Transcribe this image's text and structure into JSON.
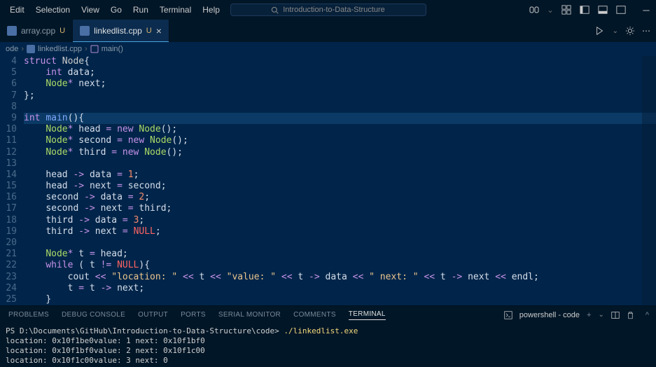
{
  "menu": [
    "Edit",
    "Selection",
    "View",
    "Go",
    "Run",
    "Terminal",
    "Help"
  ],
  "search_placeholder": "Introduction-to-Data-Structure",
  "tabs": [
    {
      "name": "array.cpp",
      "mod": "U",
      "active": false
    },
    {
      "name": "linkedlist.cpp",
      "mod": "U",
      "active": true
    }
  ],
  "breadcrumb": {
    "folder": "ode",
    "file": "linkedlist.cpp",
    "symbol": "main()"
  },
  "code_start_line": 4,
  "code_lines": [
    [
      [
        "kw",
        "struct"
      ],
      [
        "",
        ""
      ],
      [
        "",
        "Node"
      ],
      [
        "punc",
        "{"
      ]
    ],
    [
      [
        "",
        "    "
      ],
      [
        "kw",
        "int"
      ],
      [
        "",
        ""
      ],
      [
        "ident",
        "data"
      ],
      [
        "punc",
        ";"
      ]
    ],
    [
      [
        "",
        "    "
      ],
      [
        "type",
        "Node"
      ],
      [
        "op",
        "*"
      ],
      [
        "",
        ""
      ],
      [
        "ident",
        "next"
      ],
      [
        "punc",
        ";"
      ]
    ],
    [
      [
        "punc",
        "};"
      ]
    ],
    [],
    [
      [
        "kw",
        "int"
      ],
      [
        "",
        ""
      ],
      [
        "func",
        "main"
      ],
      [
        "punc",
        "()"
      ],
      [
        "punc",
        "{"
      ]
    ],
    [
      [
        "",
        "    "
      ],
      [
        "type",
        "Node"
      ],
      [
        "op",
        "*"
      ],
      [
        "",
        ""
      ],
      [
        "ident",
        "head"
      ],
      [
        "",
        ""
      ],
      [
        "op",
        "="
      ],
      [
        "",
        ""
      ],
      [
        "kw",
        "new"
      ],
      [
        "",
        ""
      ],
      [
        "type",
        "Node"
      ],
      [
        "punc",
        "();"
      ]
    ],
    [
      [
        "",
        "    "
      ],
      [
        "type",
        "Node"
      ],
      [
        "op",
        "*"
      ],
      [
        "",
        ""
      ],
      [
        "ident",
        "second"
      ],
      [
        "",
        ""
      ],
      [
        "op",
        "="
      ],
      [
        "",
        ""
      ],
      [
        "kw",
        "new"
      ],
      [
        "",
        ""
      ],
      [
        "type",
        "Node"
      ],
      [
        "punc",
        "();"
      ]
    ],
    [
      [
        "",
        "    "
      ],
      [
        "type",
        "Node"
      ],
      [
        "op",
        "*"
      ],
      [
        "",
        ""
      ],
      [
        "ident",
        "third"
      ],
      [
        "",
        ""
      ],
      [
        "op",
        "="
      ],
      [
        "",
        ""
      ],
      [
        "kw",
        "new"
      ],
      [
        "",
        ""
      ],
      [
        "type",
        "Node"
      ],
      [
        "punc",
        "();"
      ]
    ],
    [],
    [
      [
        "",
        "    "
      ],
      [
        "ident",
        "head"
      ],
      [
        "",
        ""
      ],
      [
        "op",
        "->"
      ],
      [
        "",
        ""
      ],
      [
        "ident",
        "data"
      ],
      [
        "",
        ""
      ],
      [
        "op",
        "="
      ],
      [
        "",
        ""
      ],
      [
        "num",
        "1"
      ],
      [
        "punc",
        ";"
      ]
    ],
    [
      [
        "",
        "    "
      ],
      [
        "ident",
        "head"
      ],
      [
        "",
        ""
      ],
      [
        "op",
        "->"
      ],
      [
        "",
        ""
      ],
      [
        "ident",
        "next"
      ],
      [
        "",
        ""
      ],
      [
        "op",
        "="
      ],
      [
        "",
        ""
      ],
      [
        "ident",
        "second"
      ],
      [
        "punc",
        ";"
      ]
    ],
    [
      [
        "",
        "    "
      ],
      [
        "ident",
        "second"
      ],
      [
        "",
        ""
      ],
      [
        "op",
        "->"
      ],
      [
        "",
        ""
      ],
      [
        "ident",
        "data"
      ],
      [
        "",
        ""
      ],
      [
        "op",
        "="
      ],
      [
        "",
        ""
      ],
      [
        "num",
        "2"
      ],
      [
        "punc",
        ";"
      ]
    ],
    [
      [
        "",
        "    "
      ],
      [
        "ident",
        "second"
      ],
      [
        "",
        ""
      ],
      [
        "op",
        "->"
      ],
      [
        "",
        ""
      ],
      [
        "ident",
        "next"
      ],
      [
        "",
        ""
      ],
      [
        "op",
        "="
      ],
      [
        "",
        ""
      ],
      [
        "ident",
        "third"
      ],
      [
        "punc",
        ";"
      ]
    ],
    [
      [
        "",
        "    "
      ],
      [
        "ident",
        "third"
      ],
      [
        "",
        ""
      ],
      [
        "op",
        "->"
      ],
      [
        "",
        ""
      ],
      [
        "ident",
        "data"
      ],
      [
        "",
        ""
      ],
      [
        "op",
        "="
      ],
      [
        "",
        ""
      ],
      [
        "num",
        "3"
      ],
      [
        "punc",
        ";"
      ]
    ],
    [
      [
        "",
        "    "
      ],
      [
        "ident",
        "third"
      ],
      [
        "",
        ""
      ],
      [
        "op",
        "->"
      ],
      [
        "",
        ""
      ],
      [
        "ident",
        "next"
      ],
      [
        "",
        ""
      ],
      [
        "op",
        "="
      ],
      [
        "",
        ""
      ],
      [
        "const",
        "NULL"
      ],
      [
        "punc",
        ";"
      ]
    ],
    [],
    [
      [
        "",
        "    "
      ],
      [
        "type",
        "Node"
      ],
      [
        "op",
        "*"
      ],
      [
        "",
        ""
      ],
      [
        "ident",
        "t"
      ],
      [
        "",
        ""
      ],
      [
        "op",
        "="
      ],
      [
        "",
        ""
      ],
      [
        "ident",
        "head"
      ],
      [
        "punc",
        ";"
      ]
    ],
    [
      [
        "",
        "    "
      ],
      [
        "kw",
        "while"
      ],
      [
        "",
        ""
      ],
      [
        "punc",
        "("
      ],
      [
        "",
        ""
      ],
      [
        "ident",
        "t"
      ],
      [
        "",
        ""
      ],
      [
        "op",
        "!="
      ],
      [
        "",
        ""
      ],
      [
        "const",
        "NULL"
      ],
      [
        "punc",
        "){"
      ]
    ],
    [
      [
        "",
        "        "
      ],
      [
        "ident",
        "cout"
      ],
      [
        "",
        ""
      ],
      [
        "op",
        "<<"
      ],
      [
        "",
        ""
      ],
      [
        "str",
        "\"location: \""
      ],
      [
        "",
        ""
      ],
      [
        "op",
        "<<"
      ],
      [
        "",
        ""
      ],
      [
        "ident",
        "t"
      ],
      [
        "",
        ""
      ],
      [
        "op",
        "<<"
      ],
      [
        "",
        ""
      ],
      [
        "str",
        "\"value: \""
      ],
      [
        "",
        ""
      ],
      [
        "op",
        "<<"
      ],
      [
        "",
        ""
      ],
      [
        "ident",
        "t"
      ],
      [
        "",
        ""
      ],
      [
        "op",
        "->"
      ],
      [
        "",
        ""
      ],
      [
        "ident",
        "data"
      ],
      [
        "",
        ""
      ],
      [
        "op",
        "<<"
      ],
      [
        "",
        ""
      ],
      [
        "str",
        "\" next: \""
      ],
      [
        "",
        ""
      ],
      [
        "op",
        "<<"
      ],
      [
        "",
        ""
      ],
      [
        "ident",
        "t"
      ],
      [
        "",
        ""
      ],
      [
        "op",
        "->"
      ],
      [
        "",
        ""
      ],
      [
        "ident",
        "next"
      ],
      [
        "",
        ""
      ],
      [
        "op",
        "<<"
      ],
      [
        "",
        ""
      ],
      [
        "ident",
        "endl"
      ],
      [
        "punc",
        ";"
      ]
    ],
    [
      [
        "",
        "        "
      ],
      [
        "ident",
        "t"
      ],
      [
        "",
        ""
      ],
      [
        "op",
        "="
      ],
      [
        "",
        ""
      ],
      [
        "ident",
        "t"
      ],
      [
        "",
        ""
      ],
      [
        "op",
        "->"
      ],
      [
        "",
        ""
      ],
      [
        "ident",
        "next"
      ],
      [
        "punc",
        ";"
      ]
    ],
    [
      [
        "",
        "    "
      ],
      [
        "punc",
        "}"
      ]
    ],
    [
      [
        "punc",
        "}"
      ]
    ]
  ],
  "highlight_lines": [
    9,
    26
  ],
  "panel_tabs": [
    "PROBLEMS",
    "DEBUG CONSOLE",
    "OUTPUT",
    "PORTS",
    "SERIAL MONITOR",
    "COMMENTS",
    "TERMINAL"
  ],
  "panel_active": "TERMINAL",
  "terminal_shell_label": "powershell - code",
  "terminal": {
    "prompt": "PS D:\\Documents\\GitHub\\Introduction-to-Data-Structure\\code> ",
    "cmd": "./linkedlist.exe",
    "out": [
      "location: 0x10f1be0value: 1 next: 0x10f1bf0",
      "location: 0x10f1bf0value: 2 next: 0x10f1c00",
      "location: 0x10f1c00value: 3 next: 0"
    ]
  }
}
